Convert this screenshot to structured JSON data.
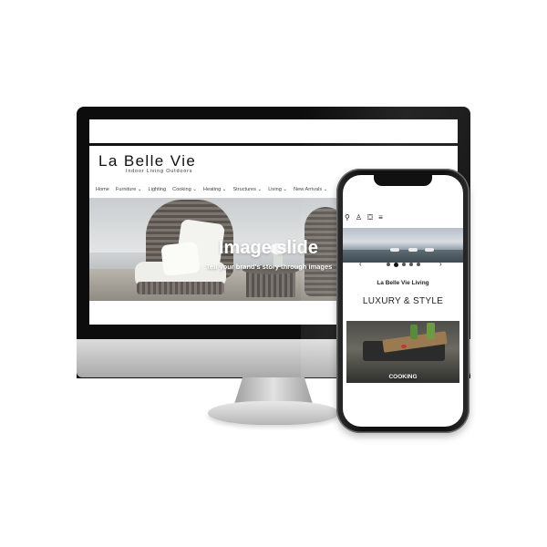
{
  "desktop": {
    "brand": "La Belle Vie",
    "tagline": "Indoor Living Outdoors",
    "nav": [
      "Home",
      "Furniture ⌄",
      "Lighting",
      "Cooking ⌄",
      "Heating ⌄",
      "Structures ⌄",
      "Living ⌄",
      "New Arrivals ⌄"
    ],
    "hero": {
      "title": "Image slide",
      "subtitle": "Tell your brand's story through images"
    }
  },
  "mobile": {
    "icons": [
      "search-icon",
      "account-icon",
      "cart-icon",
      "menu-icon"
    ],
    "icon_glyphs": {
      "search": "⚲",
      "account": "♙",
      "cart": "⛋",
      "menu": "≡"
    },
    "slider": {
      "prev": "‹",
      "next": "›",
      "dot_count": 5,
      "active_dot": 1
    },
    "brand": "La Belle Vie Living",
    "headline": "LUXURY & STYLE",
    "card_label": "COOKING"
  }
}
